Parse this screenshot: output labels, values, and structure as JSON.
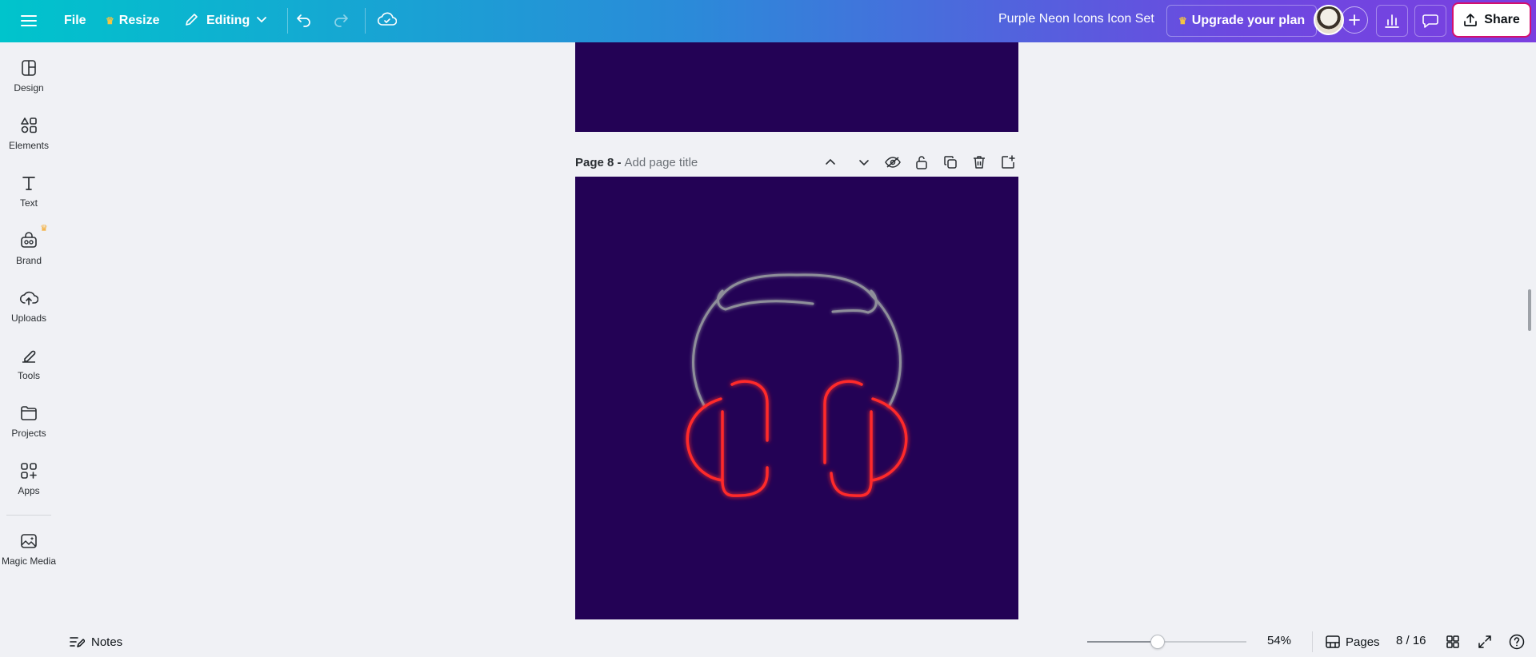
{
  "topbar": {
    "file_label": "File",
    "resize_label": "Resize",
    "editing_label": "Editing",
    "doc_title": "Purple Neon Icons Icon Set",
    "upgrade_label": "Upgrade your plan",
    "share_label": "Share"
  },
  "sidebar": {
    "items": [
      {
        "label": "Design",
        "icon": "design-icon"
      },
      {
        "label": "Elements",
        "icon": "elements-icon"
      },
      {
        "label": "Text",
        "icon": "text-icon"
      },
      {
        "label": "Brand",
        "icon": "brand-icon"
      },
      {
        "label": "Uploads",
        "icon": "uploads-icon"
      },
      {
        "label": "Tools",
        "icon": "tools-icon"
      },
      {
        "label": "Projects",
        "icon": "projects-icon"
      },
      {
        "label": "Apps",
        "icon": "apps-icon"
      },
      {
        "label": "Magic Media",
        "icon": "magic-media-icon"
      }
    ]
  },
  "canvas": {
    "page_label": "Page 8 -",
    "page_title_placeholder": "Add page title",
    "page_background": "#230255",
    "artwork": "neon-headphones"
  },
  "bottombar": {
    "notes_label": "Notes",
    "zoom_value": "54%",
    "zoom_fraction": 0.44,
    "pages_label": "Pages",
    "page_count": "8 / 16"
  },
  "colors": {
    "neon_red": "#ff2a2a",
    "neon_grey": "#8e8e9a",
    "share_outline": "#d3106f",
    "crown": "#f5a623"
  }
}
